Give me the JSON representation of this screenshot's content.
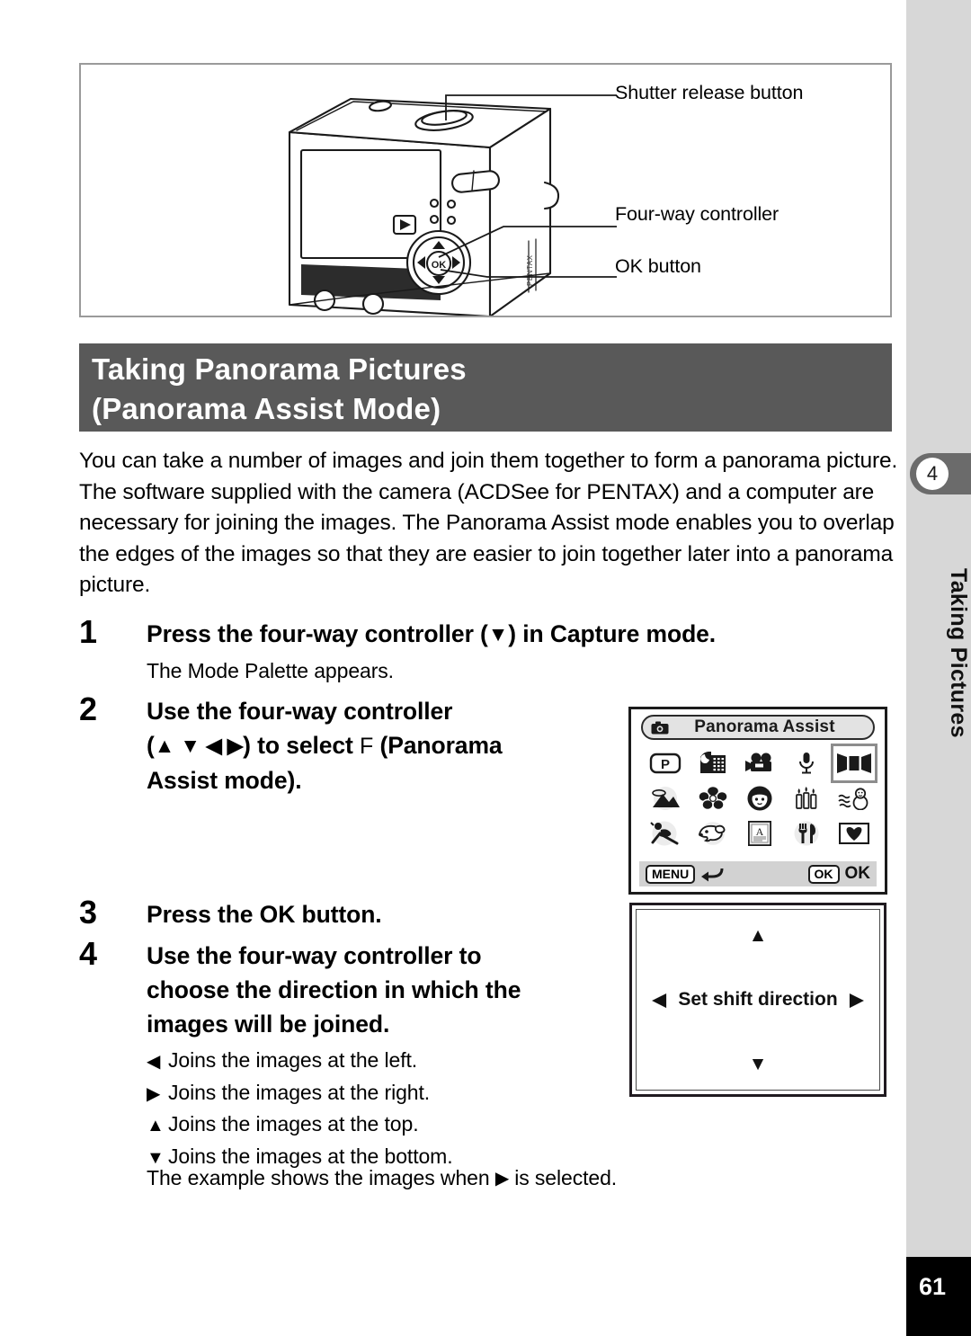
{
  "illustration": {
    "callouts": [
      {
        "name": "shutter-release-button",
        "label": "Shutter release button"
      },
      {
        "name": "four-way-controller",
        "label": "Four-way controller"
      },
      {
        "name": "ok-button",
        "label": "OK button"
      }
    ]
  },
  "title_banner": {
    "line1": "Taking Panorama Pictures",
    "line2": "(Panorama Assist Mode)",
    "background": "#595959",
    "color": "#ffffff"
  },
  "intro": {
    "paragraph": "You can take a number of images and join them together to form a panorama picture. The software supplied with the camera (ACDSee for PENTAX) and a computer are necessary for joining the images. The Panorama Assist mode enables you to overlap the edges of the images so that they are easier to join together later into a panorama picture."
  },
  "steps": [
    {
      "number": "1",
      "head_before": "Press the four-way controller (",
      "head_arrow": "▼",
      "head_after": ") in Capture mode.",
      "sub": "The Mode Palette appears."
    },
    {
      "number": "2",
      "head_line1": "Use the four-way controller",
      "head_line2_a": "(",
      "head_line2_arrows": "▲ ▼ ◀ ▶",
      "head_line2_b": ") to select ",
      "head_line2_mode": "F",
      "head_line2_c": "  (Panorama",
      "head_line3": "Assist mode)."
    },
    {
      "number": "3",
      "head": "Press the OK button."
    },
    {
      "number": "4",
      "head_line1": "Use the four-way controller to",
      "head_line2": "choose the direction in which the",
      "head_line3": "images will be joined."
    }
  ],
  "direction_list": [
    {
      "arrow": "◀",
      "text": "Joins the images at the left."
    },
    {
      "arrow": "▶",
      "text": "Joins the images at the right."
    },
    {
      "arrow": "▲",
      "text": "Joins the images at the top."
    },
    {
      "arrow": "▼",
      "text": "Joins the images at the bottom."
    }
  ],
  "example_note": {
    "before": "The example shows the images when ",
    "arrow": "▶",
    "after": " is selected."
  },
  "mode_palette": {
    "title": "Panorama Assist",
    "icons": [
      "program-mode-icon",
      "night-scene-icon",
      "movie-icon",
      "voice-recording-icon",
      "panorama-assist-icon",
      "landscape-icon",
      "flower-icon",
      "portrait-icon",
      "candlelight-icon",
      "snow-icon",
      "sport-icon",
      "pet-icon",
      "text-icon",
      "food-icon",
      "frame-composite-icon"
    ],
    "selected_index": 4,
    "footer": {
      "menu_key": "MENU",
      "menu_action_icon": "back-arrow-icon",
      "ok_key": "OK",
      "ok_label": "OK"
    }
  },
  "shift_screen": {
    "label": "Set shift direction",
    "up": "▲",
    "down": "▼",
    "left": "◀",
    "right": "▶"
  },
  "sidebar": {
    "chapter_number": "4",
    "chapter_title": "Taking Pictures",
    "page_number": "61",
    "tab_color": "#6b6b6b",
    "bg_color": "#d7d7d7"
  }
}
